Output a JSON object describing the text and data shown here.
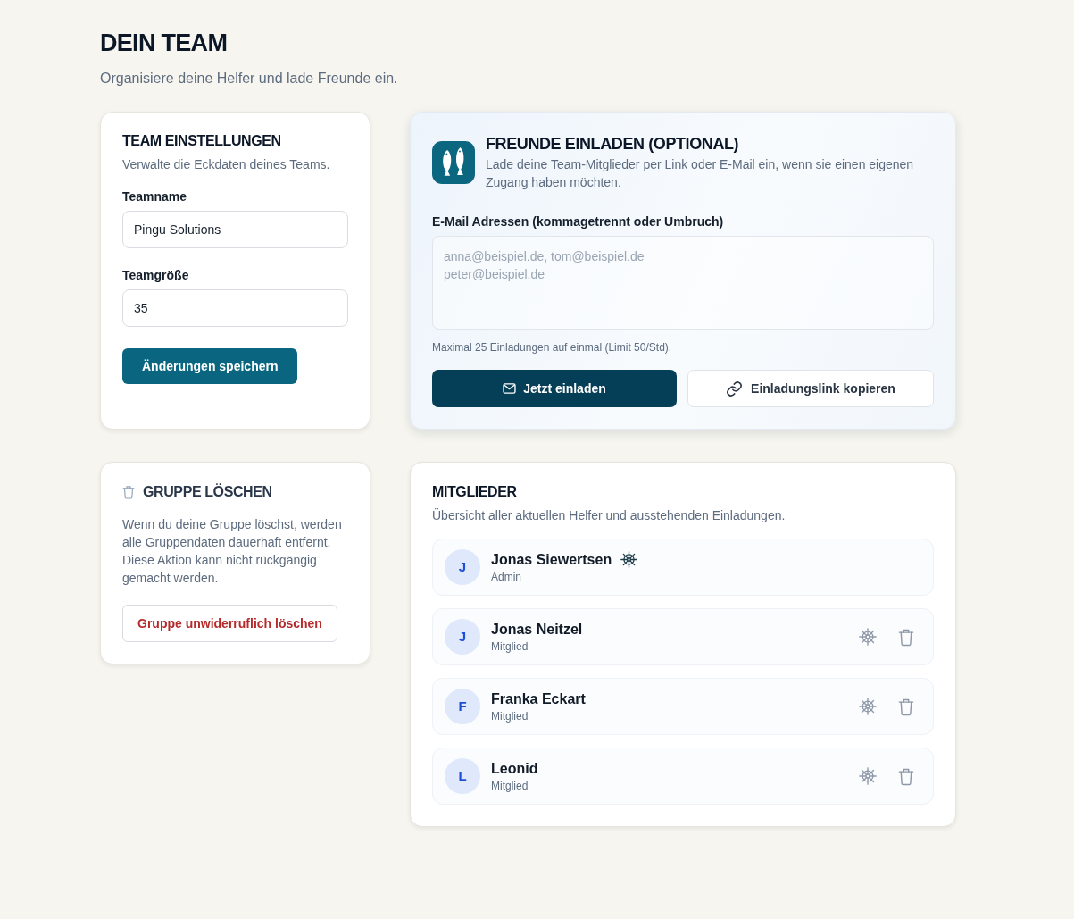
{
  "page": {
    "title": "DEIN TEAM",
    "subtitle": "Organisiere deine Helfer und lade Freunde ein."
  },
  "team_settings": {
    "title": "TEAM EINSTELLUNGEN",
    "subtitle": "Verwalte die Eckdaten deines Teams.",
    "fields": [
      {
        "label": "Teamname",
        "value": "Pingu Solutions"
      },
      {
        "label": "Teamgröße",
        "value": "35"
      }
    ],
    "save_button": "Änderungen speichern"
  },
  "invite": {
    "title": "FREUNDE EINLADEN (OPTIONAL)",
    "description": "Lade deine Team-Mitglieder per Link oder E-Mail ein, wenn sie einen eigenen Zugang haben möchten.",
    "email_label": "E-Mail Adressen (kommagetrennt oder Umbruch)",
    "email_placeholder": "anna@beispiel.de, tom@beispiel.de\npeter@beispiel.de",
    "hint": "Maximal 25 Einladungen auf einmal (Limit 50/Std).",
    "invite_button": "Jetzt einladen",
    "copy_link_button": "Einladungslink kopieren"
  },
  "delete_group": {
    "title": "GRUPPE LÖSCHEN",
    "description": "Wenn du deine Gruppe löschst, werden alle Gruppendaten dauerhaft entfernt. Diese Aktion kann nicht rückgängig gemacht werden.",
    "delete_button": "Gruppe unwiderruflich löschen"
  },
  "members": {
    "title": "MITGLIEDER",
    "subtitle": "Übersicht aller aktuellen Helfer und ausstehenden Einladungen.",
    "items": [
      {
        "kind": "admin",
        "initial": "J",
        "name": "Jonas Siewertsen",
        "role": "Admin"
      },
      {
        "kind": "member",
        "initial": "J",
        "name": "Jonas Neitzel",
        "role": "Mitglied"
      },
      {
        "kind": "member",
        "initial": "F",
        "name": "Franka Eckart",
        "role": "Mitglied"
      },
      {
        "kind": "member",
        "initial": "L",
        "name": "Leonid",
        "role": "Mitglied"
      }
    ]
  }
}
